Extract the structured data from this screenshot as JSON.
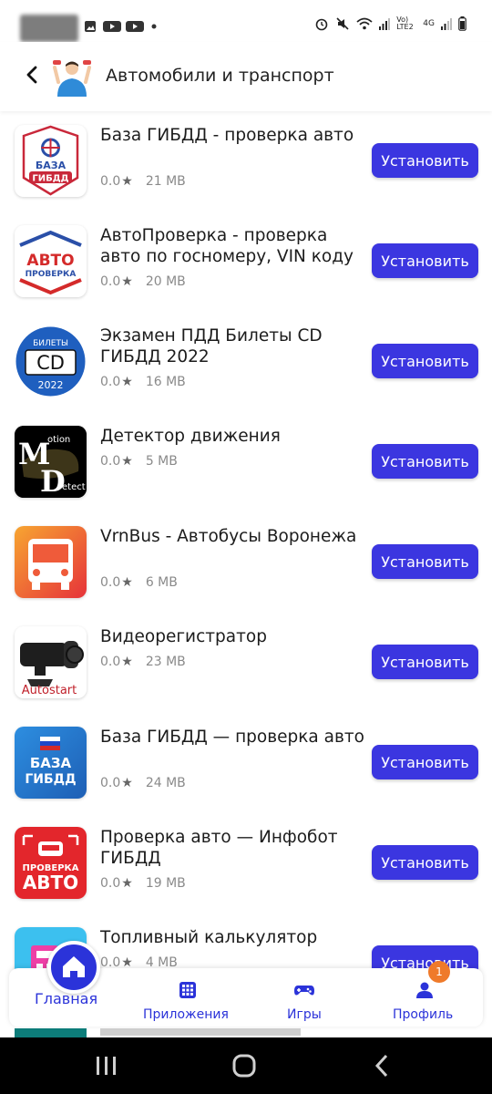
{
  "status_bar": {
    "icons": [
      "image-icon",
      "youtube-icon",
      "youtube-icon",
      "dot-icon"
    ],
    "right_icons": [
      "alarm-icon",
      "mute-icon",
      "wifi-icon",
      "signal-icon",
      "signal-icon",
      "battery-icon"
    ],
    "network_a": "Vo) LTE2",
    "network_b": "4G"
  },
  "header": {
    "title": "Автомобили и транспорт",
    "back_icon": "arrow-left-icon",
    "category_icon": "person-holding-car-icon"
  },
  "apps": [
    {
      "name": "База ГИБДД - проверка авто",
      "rating": "0.0",
      "size": "21 MB",
      "button": "Установить",
      "icon": "gibdd-badge-icon"
    },
    {
      "name": "АвтоПроверка - проверка авто по госномеру, VIN коду",
      "rating": "0.0",
      "size": "20 MB",
      "button": "Установить",
      "icon": "avto-proverka-icon",
      "icon_text_a": "АВТО",
      "icon_text_b": "ПРОВЕРКА"
    },
    {
      "name": "Экзамен ПДД Билеты CD ГИБДД 2022",
      "rating": "0.0",
      "size": "16 MB",
      "button": "Установить",
      "icon": "pdd-tickets-icon",
      "icon_text_a": "БИЛЕТЫ",
      "icon_text_b": "CD",
      "icon_text_c": "2022"
    },
    {
      "name": "Детектор движения",
      "rating": "0.0",
      "size": "5 MB",
      "button": "Установить",
      "icon": "motion-detect-icon",
      "icon_text_a": "otion",
      "icon_text_b": "etect"
    },
    {
      "name": "VrnBus - Автобусы Воронежа",
      "rating": "0.0",
      "size": "6 MB",
      "button": "Установить",
      "icon": "bus-icon"
    },
    {
      "name": "Видеорегистратор",
      "rating": "0.0",
      "size": "23 MB",
      "button": "Установить",
      "icon": "dashcam-icon",
      "icon_text_a": "Autostart"
    },
    {
      "name": "База ГИБДД — проверка авто",
      "rating": "0.0",
      "size": "24 MB",
      "button": "Установить",
      "icon": "gibdd-flag-icon",
      "icon_text_a": "БАЗА",
      "icon_text_b": "ГИБДД"
    },
    {
      "name": "Проверка авто — Инфобот ГИБДД",
      "rating": "0.0",
      "size": "19 MB",
      "button": "Установить",
      "icon": "infobot-icon",
      "icon_text_a": "ПРОВЕРКА",
      "icon_text_b": "АВТО"
    },
    {
      "name": "Топливный калькулятор",
      "rating": "0.0",
      "size": "4 MB",
      "button": "Установить",
      "icon": "fuel-calculator-icon"
    }
  ],
  "bottom_nav": {
    "home": "Главная",
    "apps": "Приложения",
    "games": "Игры",
    "profile": "Профиль",
    "badge": "1"
  },
  "colors": {
    "accent": "#3b36e0",
    "nav_accent": "#2b33d9",
    "badge": "#ef7a2a"
  }
}
